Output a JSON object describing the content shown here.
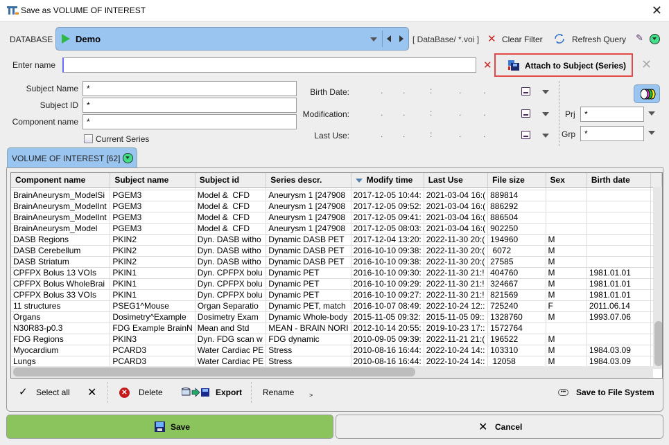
{
  "window": {
    "title": "Save as VOLUME OF INTEREST"
  },
  "database": {
    "label": "DATABASE",
    "selected": "Demo",
    "path_filter": "[ DataBase/ *.voi ]",
    "clear_filter": "Clear Filter",
    "refresh_query": "Refresh Query"
  },
  "name_entry": {
    "label": "Enter name",
    "value": "",
    "attach_label": "Attach to Subject (Series)"
  },
  "filters": {
    "subject_name_label": "Subject Name",
    "subject_name_value": "*",
    "subject_id_label": "Subject ID",
    "subject_id_value": "*",
    "component_name_label": "Component name",
    "component_name_value": "*",
    "current_series_label": "Current Series",
    "current_series_checked": false,
    "birth_date_label": "Birth Date:",
    "modification_label": "Modification:",
    "last_use_label": "Last Use:",
    "date_placeholder": [
      ".",
      ".",
      ":",
      ".",
      "."
    ],
    "prj_label": "Prj",
    "prj_value": "*",
    "grp_label": "Grp",
    "grp_value": "*"
  },
  "tab": {
    "label": "VOLUME OF INTEREST [62]"
  },
  "table": {
    "sorted_column": "Modify time",
    "columns": [
      "Component name",
      "Subject name",
      "Subject id",
      "Series descr.",
      "Modify time",
      "Last Use",
      "File size",
      "Sex",
      "Birth date"
    ],
    "rows": [
      [
        "BrainAneurysm_ModelSi",
        "PGEM3",
        "Model &  CFD",
        "Aneurysm 1 [247908",
        "2017-12-05 10:44:",
        "2021-03-04 16:(",
        "889814",
        "",
        ""
      ],
      [
        "BrainAneurysm_ModelInt",
        "PGEM3",
        "Model &  CFD",
        "Aneurysm 1 [247908",
        "2017-12-05 09:52:",
        "2021-03-04 16:(",
        "886292",
        "",
        ""
      ],
      [
        "BrainAneurysm_ModelInt",
        "PGEM3",
        "Model &  CFD",
        "Aneurysm 1 [247908",
        "2017-12-05 09:41:",
        "2021-03-04 16:(",
        "886504",
        "",
        ""
      ],
      [
        "BrainAneurysm_Model",
        "PGEM3",
        "Model &  CFD",
        "Aneurysm 1 [247908",
        "2017-12-05 08:03:",
        "2021-03-04 16:(",
        "902250",
        "",
        ""
      ],
      [
        "DASB Regions",
        "PKIN2",
        "Dyn. DASB witho",
        "Dynamic DASB PET",
        "2017-12-04 13:20:",
        "2022-11-30 20:(",
        "194960",
        "M",
        ""
      ],
      [
        "DASB Cerebellum",
        "PKIN2",
        "Dyn. DASB witho",
        "Dynamic DASB PET",
        "2016-10-10 09:38:",
        "2022-11-30 20:(",
        " 6072",
        "M",
        ""
      ],
      [
        "DASB Striatum",
        "PKIN2",
        "Dyn. DASB witho",
        "Dynamic DASB PET",
        "2016-10-10 09:38:",
        "2022-11-30 20:(",
        "27585",
        "M",
        ""
      ],
      [
        "CPFPX Bolus 13 VOIs",
        "PKIN1",
        "Dyn. CPFPX bolu",
        "Dynamic PET",
        "2016-10-10 09:30:",
        "2022-11-30 21:!",
        "404760",
        "M",
        "1981.01.01"
      ],
      [
        "CPFPX Bolus WholeBrai",
        "PKIN1",
        "Dyn. CPFPX bolu",
        "Dynamic PET",
        "2016-10-10 09:29:",
        "2022-11-30 21:!",
        "324667",
        "M",
        "1981.01.01"
      ],
      [
        "CPFPX Bolus 33 VOIs",
        "PKIN1",
        "Dyn. CPFPX bolu",
        "Dynamic PET",
        "2016-10-10 09:27:",
        "2022-11-30 21:!",
        "821569",
        "M",
        "1981.01.01"
      ],
      [
        "11 structures",
        "PSEG1^Mouse",
        "Organ Separatio",
        "Dynamic PET, match",
        "2016-10-07 08:49:",
        "2022-10-24 12::",
        "725240",
        "F",
        "2011.06.14"
      ],
      [
        "Organs",
        "Dosimetry^Example",
        "Dosimetry Exam",
        "Dynamic Whole-body",
        "2015-11-05 09:32:",
        "2015-11-05 09::",
        "1328760",
        "M",
        "1993.07.06"
      ],
      [
        "N30R83-p0.3",
        "FDG Example BrainN",
        "Mean and Std",
        "MEAN - BRAIN NORI",
        "2012-10-14 20:55:",
        "2019-10-23 17::",
        "1572764",
        "",
        ""
      ],
      [
        "FDG Regions",
        "PKIN3",
        "Dyn. FDG scan w",
        "FDG dynamic",
        "2010-09-05 09:39:",
        "2022-11-21 21:(",
        "196522",
        "M",
        ""
      ],
      [
        "Myocardium",
        "PCARD3",
        "Water Cardiac PE",
        "Stress",
        "2010-08-16 16:44:",
        "2022-10-24 14::",
        "103310",
        "M",
        "1984.03.09"
      ],
      [
        "Lungs",
        "PCARD3",
        "Water Cardiac PE",
        "Stress",
        "2010-08-16 16:44:",
        "2022-10-24 14::",
        " 12058",
        "M",
        "1984.03.09"
      ]
    ]
  },
  "toolbar": {
    "select_all": "Select all",
    "delete": "Delete",
    "export": "Export",
    "rename": "Rename",
    "more": ">",
    "save_to_fs": "Save to File System"
  },
  "buttons": {
    "save": "Save",
    "cancel": "Cancel"
  },
  "colors": {
    "accent_blue": "#99c5f0",
    "save_green": "#8bc45c",
    "highlight_red": "#e34848",
    "status_green": "#44dd88"
  }
}
